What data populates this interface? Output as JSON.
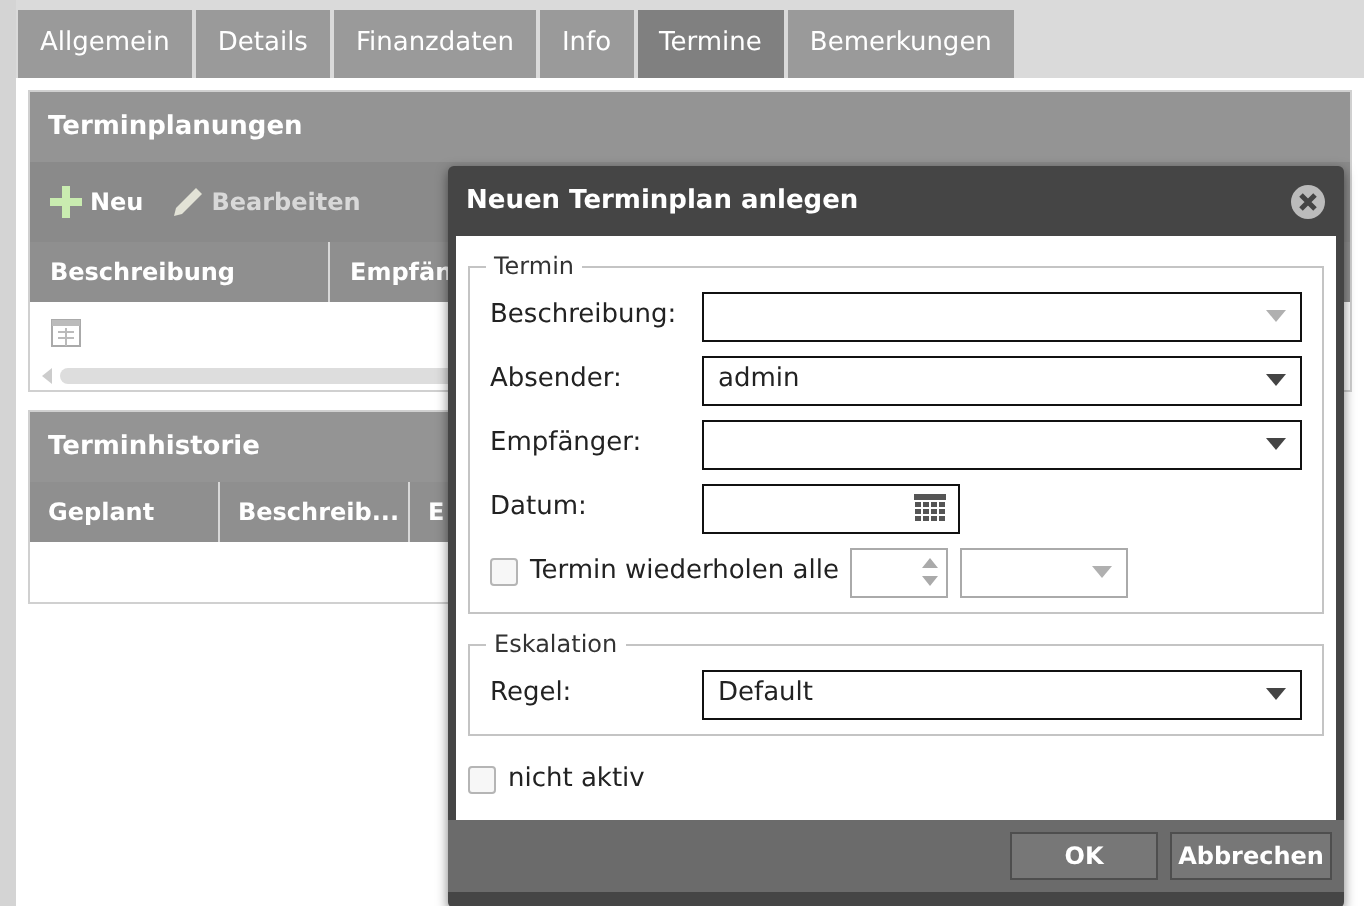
{
  "tabs": [
    {
      "label": "Allgemein",
      "selected": false
    },
    {
      "label": "Details",
      "selected": false
    },
    {
      "label": "Finanzdaten",
      "selected": false
    },
    {
      "label": "Info",
      "selected": false
    },
    {
      "label": "Termine",
      "selected": true
    },
    {
      "label": "Bemerkungen",
      "selected": false
    }
  ],
  "planning_panel": {
    "title": "Terminplanungen",
    "toolbar": [
      {
        "label": "Neu",
        "kind": "add",
        "disabled": false
      },
      {
        "label": "Bearbeiten",
        "kind": "edit",
        "disabled": true
      }
    ],
    "columns": [
      "Beschreibung",
      "Empfän"
    ]
  },
  "history_panel": {
    "title": "Terminhistorie",
    "columns": [
      "Geplant",
      "Beschreib...",
      "E"
    ]
  },
  "dialog": {
    "title": "Neuen Terminplan anlegen",
    "groups": [
      {
        "legend": "Termin",
        "fields": [
          {
            "kind": "combo",
            "label": "Beschreibung:",
            "disabled": true
          },
          {
            "kind": "combo",
            "label": "Absender:",
            "value": "admin",
            "disabled": false
          },
          {
            "kind": "combo",
            "label": "Empfänger:",
            "disabled": false
          },
          {
            "kind": "date",
            "label": "Datum:"
          },
          {
            "kind": "repeat",
            "label": "Termin wiederholen alle",
            "checked": false
          }
        ]
      },
      {
        "legend": "Eskalation",
        "fields": [
          {
            "kind": "combo",
            "label": "Regel:",
            "value": "Default",
            "disabled": false
          }
        ]
      }
    ],
    "inactive": {
      "label": "nicht aktiv",
      "checked": false
    },
    "buttons": [
      "OK",
      "Abbrechen"
    ]
  }
}
